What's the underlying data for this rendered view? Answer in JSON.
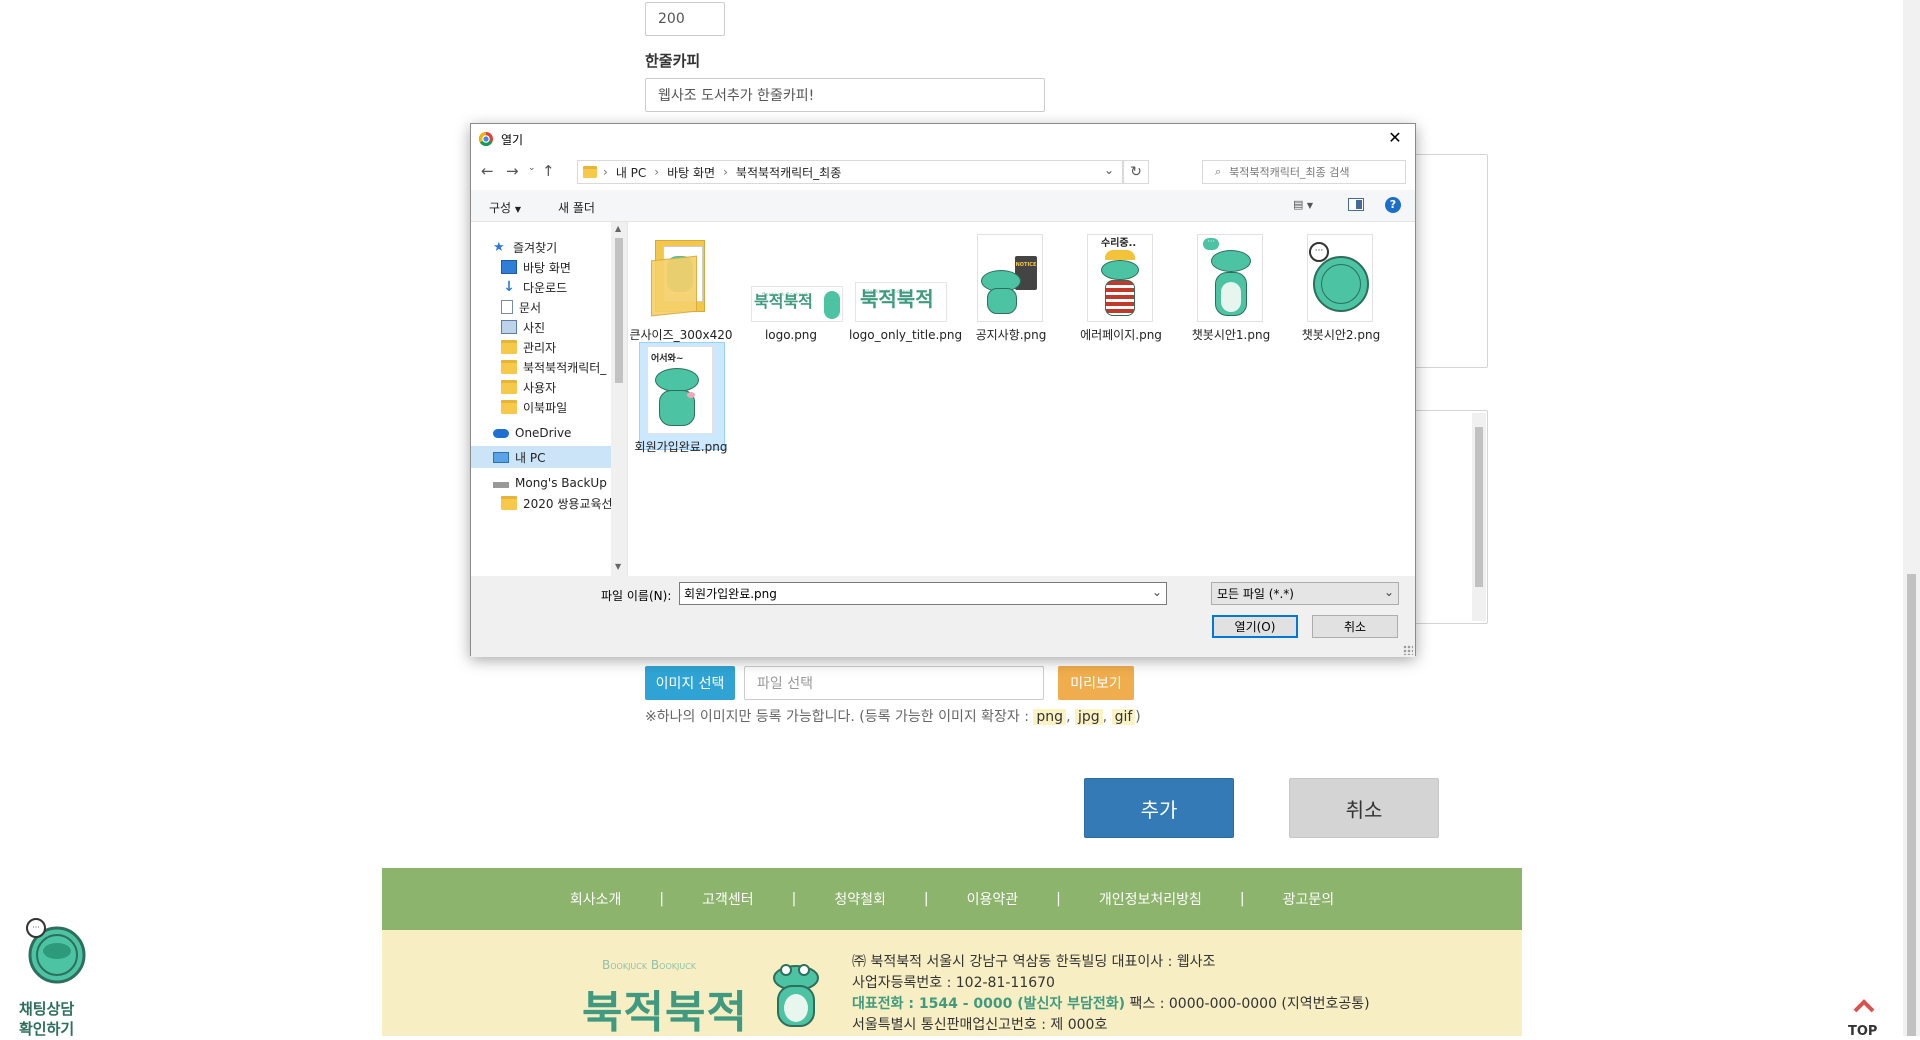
{
  "page": {
    "quantity_value": "200",
    "copy_label": "한줄카피",
    "copy_value": "웹사조 도서추가 한줄카피!",
    "image_select_label": "이미지 선택",
    "file_placeholder": "파일 선택",
    "preview_label": "미리보기",
    "note_prefix": "※하나의 이미지만 등록 가능합니다. (등록 가능한 이미지 확장자 : ",
    "ext_png": "png",
    "ext_jpg": "jpg",
    "ext_gif": "gif",
    "note_sep": ",",
    "note_suffix": ")",
    "add_label": "추가",
    "cancel_label": "취소"
  },
  "footer": {
    "nav": [
      "회사소개",
      "고객센터",
      "청약철회",
      "이용약관",
      "개인정보처리방침",
      "광고문의"
    ],
    "separator": "|",
    "logo_sub": "Bookjuck Bookjuck",
    "logo_main": "북적북적",
    "line1": "㈜ 북적북적   서울시 강남구 역삼동 한독빌딩   대표이사 : 웹사조",
    "line2": "사업자등록번호 : 102-81-11670",
    "line3_bold": "대표전화 : 1544 - 0000 (발신자 부담전화)",
    "line3_rest": "   팩스 : 0000-000-0000 (지역번호공통)",
    "line4": "서울특별시 통신판매업신고번호 : 제 000호"
  },
  "chat_widget": {
    "line1": "채팅상담",
    "line2": "확인하기"
  },
  "top_button": {
    "label": "TOP"
  },
  "dialog": {
    "title": "열기",
    "breadcrumb": [
      "내 PC",
      "바탕 화면",
      "북적북적캐릭터_최종"
    ],
    "search_placeholder": "북적북적캐릭터_최종 검색",
    "organize_label": "구성",
    "new_folder_label": "새 폴더",
    "nav_items": [
      {
        "label": "즐겨찾기",
        "icon": "star-icon"
      },
      {
        "label": "바탕 화면",
        "icon": "desktop-icon"
      },
      {
        "label": "다운로드",
        "icon": "download-icon"
      },
      {
        "label": "문서",
        "icon": "document-icon"
      },
      {
        "label": "사진",
        "icon": "picture-icon"
      },
      {
        "label": "관리자",
        "icon": "folder-icon"
      },
      {
        "label": "북적북적캐릭터_",
        "icon": "folder-icon"
      },
      {
        "label": "사용자",
        "icon": "folder-icon"
      },
      {
        "label": "이북파일",
        "icon": "folder-icon"
      },
      {
        "label": "OneDrive",
        "icon": "cloud-icon"
      },
      {
        "label": "내 PC",
        "icon": "pc-icon"
      },
      {
        "label": "Mong's BackUp (I",
        "icon": "drive-icon"
      },
      {
        "label": "2020 쌍용교육선",
        "icon": "folder-icon"
      }
    ],
    "files": [
      {
        "name": "큰사이즈_300x420",
        "type": "folder"
      },
      {
        "name": "logo.png",
        "type": "logo"
      },
      {
        "name": "logo_only_title.png",
        "type": "logo-title"
      },
      {
        "name": "공지사항.png",
        "type": "croc-notice"
      },
      {
        "name": "에러페이지.png",
        "type": "croc-error"
      },
      {
        "name": "챗봇시안1.png",
        "type": "croc-chat1"
      },
      {
        "name": "챗봇시안2.png",
        "type": "croc-chat2"
      },
      {
        "name": "회원가입완료.png",
        "type": "croc-welcome"
      }
    ],
    "thumb_texts": {
      "notice": "NOTICE",
      "error": "수리중..",
      "welcome": "어서와~",
      "logo_sub": "Bookjuck Bookjuck",
      "logo_main": "북적북적"
    },
    "filename_label": "파일 이름(N):",
    "filename_value": "회원가입완료.png",
    "filter_value": "모든 파일 (*.*)",
    "open_label": "열기(O)",
    "cancel_label": "취소"
  },
  "colors": {
    "primary_blue": "#337ab7",
    "image_btn": "#2fa4d4",
    "preview_btn": "#f0ad4e",
    "footer_green": "#8cb46c",
    "footer_cream": "#f7eec4",
    "croc_green": "#4cc3a2",
    "logo_green": "#3f9a7f"
  }
}
